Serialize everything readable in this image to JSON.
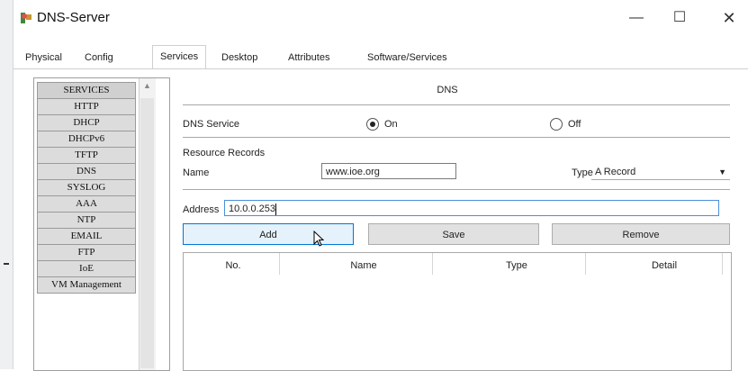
{
  "window": {
    "title": "DNS-Server",
    "controls": {
      "minimize": "—",
      "maximize": "☐",
      "close": "✕"
    }
  },
  "tabs": [
    {
      "label": "Physical"
    },
    {
      "label": "Config"
    },
    {
      "label": "Services",
      "active": true
    },
    {
      "label": "Desktop"
    },
    {
      "label": "Attributes"
    },
    {
      "label": "Software/Services"
    }
  ],
  "services": {
    "header": "SERVICES",
    "items": [
      "HTTP",
      "DHCP",
      "DHCPv6",
      "TFTP",
      "DNS",
      "SYSLOG",
      "AAA",
      "NTP",
      "EMAIL",
      "FTP",
      "IoE",
      "VM Management"
    ]
  },
  "dns": {
    "section_title": "DNS",
    "service_label": "DNS Service",
    "on_label": "On",
    "off_label": "Off",
    "selected": "On",
    "resource_records_label": "Resource Records",
    "name_label": "Name",
    "name_value": "www.ioe.org",
    "type_label": "Type",
    "type_value": "A Record",
    "address_label": "Address",
    "address_value": "10.0.0.253",
    "buttons": {
      "add": "Add",
      "save": "Save",
      "remove": "Remove"
    },
    "table_columns": [
      "No.",
      "Name",
      "Type",
      "Detail"
    ]
  },
  "colors": {
    "focus_border": "#4a90d9",
    "hover_button": "#e5f1fb",
    "hover_border": "#0078d7"
  },
  "icons": {
    "app": "dns-server-icon",
    "cursor": "mouse-pointer-icon"
  }
}
